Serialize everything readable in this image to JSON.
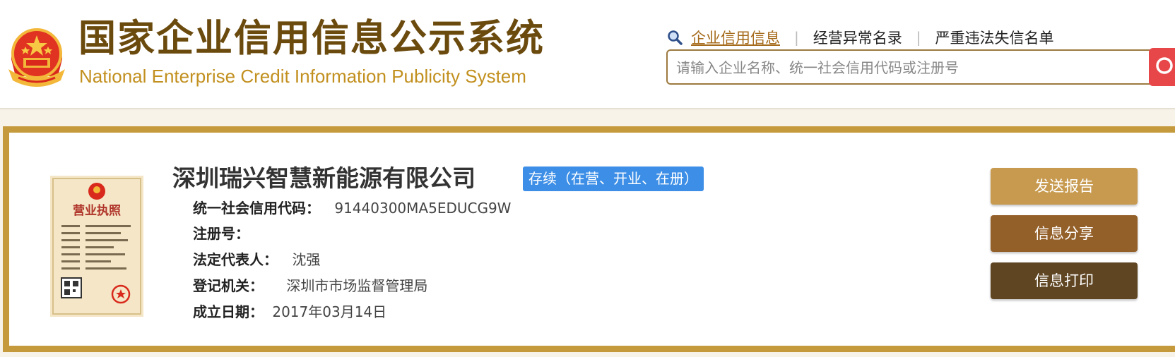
{
  "header": {
    "title": "国家企业信用信息公示系统",
    "subtitle": "National Enterprise Credit Information Publicity System",
    "nav": [
      "企业信用信息",
      "经营异常名录",
      "严重违法失信名单"
    ],
    "nav_active_index": 0,
    "search_placeholder": "请输入企业名称、统一社会信用代码或注册号"
  },
  "company": {
    "name": "深圳瑞兴智慧新能源有限公司",
    "status": "存续（在营、开业、在册）",
    "fields": [
      {
        "label": "统一社会信用代码：",
        "value": "91440300MA5EDUCG9W"
      },
      {
        "label": "注册号：",
        "value": ""
      },
      {
        "label": "法定代表人：",
        "value": "沈强"
      },
      {
        "label": "登记机关：",
        "value": "深圳市市场监督管理局"
      },
      {
        "label": "成立日期：",
        "value": "2017年03月14日"
      }
    ],
    "license_image": {
      "title": "营业执照"
    }
  },
  "actions": {
    "send_report": "发送报告",
    "share": "信息分享",
    "print": "信息打印"
  },
  "colors": {
    "brand_brown": "#6b4a0e",
    "brand_gold": "#c59a3d",
    "status_blue": "#3c8ee6",
    "search_red": "#e8474a"
  }
}
